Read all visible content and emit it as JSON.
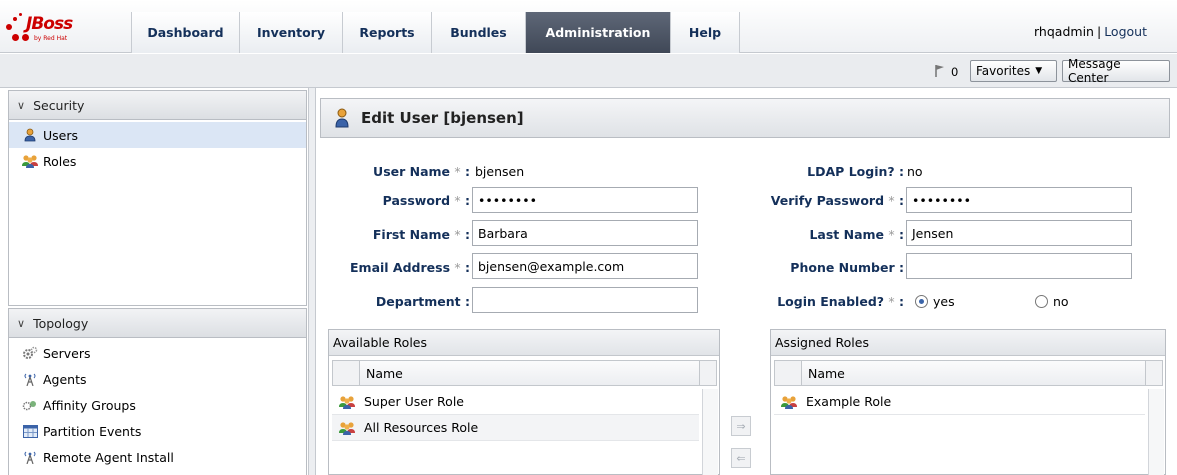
{
  "brand": {
    "logo_text": "JBoss",
    "logo_sub": "by Red Hat"
  },
  "nav": {
    "tabs": [
      {
        "label": "Dashboard",
        "active": false
      },
      {
        "label": "Inventory",
        "active": false
      },
      {
        "label": "Reports",
        "active": false
      },
      {
        "label": "Bundles",
        "active": false
      },
      {
        "label": "Administration",
        "active": true
      },
      {
        "label": "Help",
        "active": false
      }
    ]
  },
  "user": {
    "name": "rhqadmin",
    "separator": "|",
    "logout": "Logout"
  },
  "toolbar": {
    "alert_count": "0",
    "favorites": "Favorites",
    "message_center": "Message Center"
  },
  "sidebar": {
    "sections": [
      {
        "title": "Security",
        "items": [
          {
            "label": "Users",
            "icon": "user-icon",
            "selected": true
          },
          {
            "label": "Roles",
            "icon": "roles-icon",
            "selected": false
          }
        ]
      },
      {
        "title": "Topology",
        "items": [
          {
            "label": "Servers",
            "icon": "servers-icon"
          },
          {
            "label": "Agents",
            "icon": "agent-icon"
          },
          {
            "label": "Affinity Groups",
            "icon": "affinity-groups-icon"
          },
          {
            "label": "Partition Events",
            "icon": "partition-events-icon"
          },
          {
            "label": "Remote Agent Install",
            "icon": "remote-agent-install-icon"
          }
        ]
      }
    ]
  },
  "form": {
    "title": "Edit User [bjensen]",
    "user_name": {
      "label": "User Name",
      "required": "*",
      "value": "bjensen"
    },
    "ldap_login": {
      "label": "LDAP Login? :",
      "value": "no"
    },
    "password": {
      "label": "Password",
      "required": "*",
      "value": "••••••••"
    },
    "verify_password": {
      "label": "Verify Password",
      "required": "*",
      "value": "••••••••"
    },
    "first_name": {
      "label": "First Name",
      "required": "*",
      "value": "Barbara"
    },
    "last_name": {
      "label": "Last Name",
      "required": "*",
      "value": "Jensen"
    },
    "email": {
      "label": "Email Address",
      "required": "*",
      "value": "bjensen@example.com"
    },
    "phone": {
      "label": "Phone Number :",
      "value": ""
    },
    "department": {
      "label": "Department :",
      "value": ""
    },
    "login_enabled": {
      "label": "Login Enabled?",
      "required": "*",
      "options": [
        "yes",
        "no"
      ],
      "selected": "yes"
    }
  },
  "roles": {
    "available": {
      "title": "Available Roles",
      "column": "Name",
      "rows": [
        "Super User Role",
        "All Resources Role"
      ]
    },
    "assigned": {
      "title": "Assigned Roles",
      "column": "Name",
      "rows": [
        "Example Role"
      ]
    },
    "buttons": {
      "add": "⇒",
      "remove": "⇐"
    }
  },
  "colors": {
    "nav_active": "#4e5666",
    "label_blue": "#14305a",
    "selected_row": "#dbe6f5",
    "logo_red": "#cc0000"
  }
}
